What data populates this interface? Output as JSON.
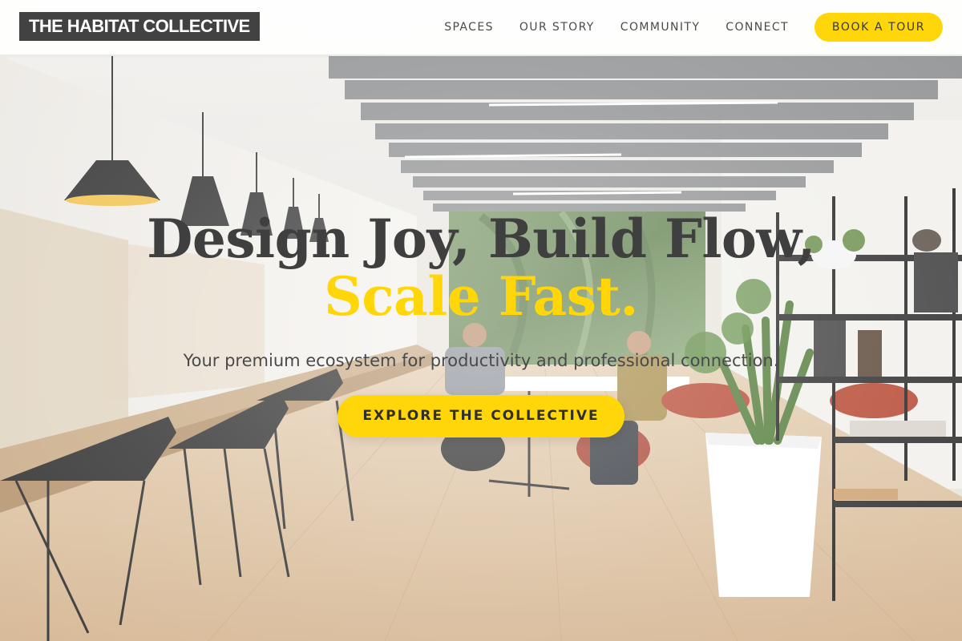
{
  "header": {
    "logo_text": "THE HABITAT COLLECTIVE",
    "nav": [
      {
        "label": "SPACES"
      },
      {
        "label": "OUR STORY"
      },
      {
        "label": "COMMUNITY"
      },
      {
        "label": "CONNECT"
      }
    ],
    "cta_label": "BOOK A TOUR"
  },
  "hero": {
    "headline_line1": "Design Joy, Build Flow,",
    "headline_line2": "Scale Fast.",
    "subtitle": "Your premium ecosystem for productivity and professional connection.",
    "cta_label": "EXPLORE THE COLLECTIVE",
    "background": "coworking-office-photo"
  },
  "colors": {
    "accent": "#ffd60a",
    "logo_bg": "#424242",
    "headline": "#3f3f3f",
    "body_text": "#4a4a4a",
    "header_bg": "#ffffff"
  }
}
